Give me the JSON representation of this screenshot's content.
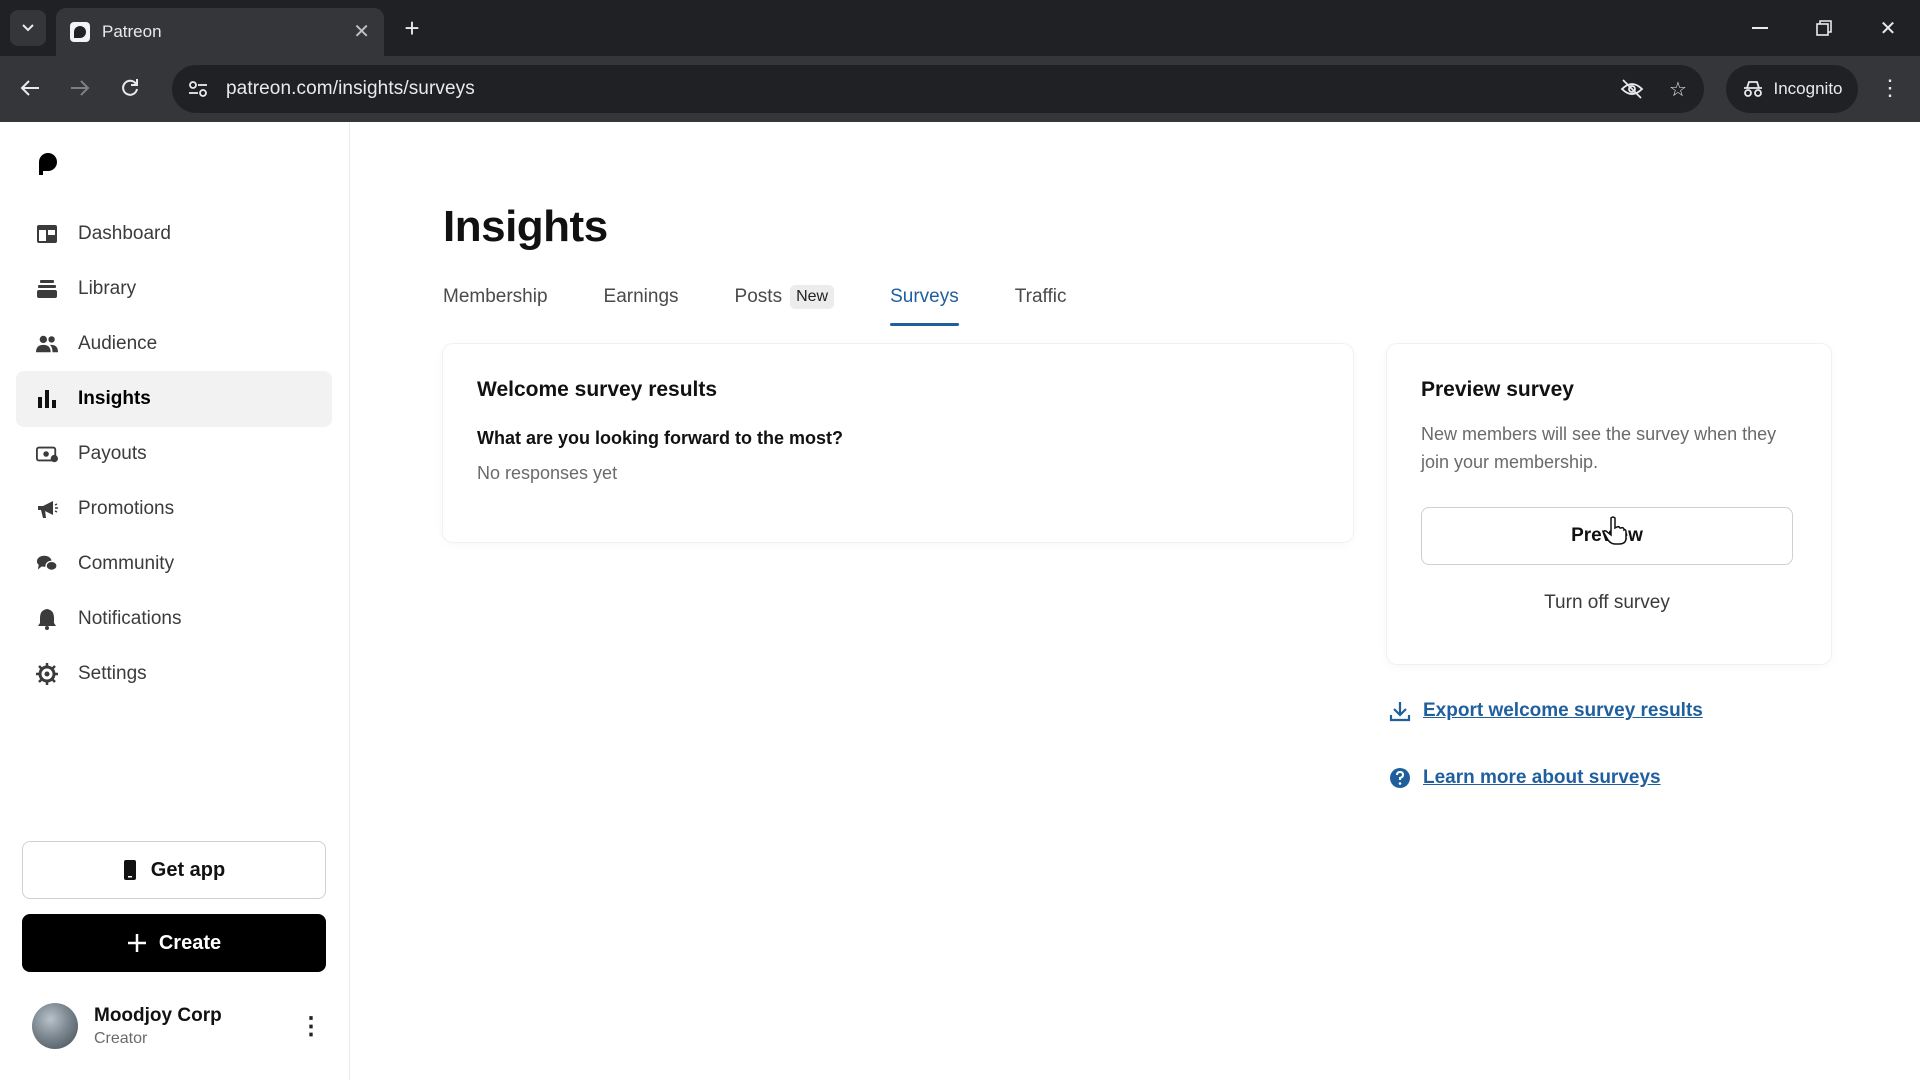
{
  "browser": {
    "tab_title": "Patreon",
    "url": "patreon.com/insights/surveys",
    "incognito_label": "Incognito"
  },
  "sidebar": {
    "items": [
      {
        "label": "Dashboard",
        "icon": "dashboard-icon",
        "active": false
      },
      {
        "label": "Library",
        "icon": "library-icon",
        "active": false
      },
      {
        "label": "Audience",
        "icon": "audience-icon",
        "active": false
      },
      {
        "label": "Insights",
        "icon": "insights-icon",
        "active": true
      },
      {
        "label": "Payouts",
        "icon": "payouts-icon",
        "active": false
      },
      {
        "label": "Promotions",
        "icon": "promotions-icon",
        "active": false
      },
      {
        "label": "Community",
        "icon": "community-icon",
        "active": false
      },
      {
        "label": "Notifications",
        "icon": "notifications-icon",
        "active": false
      },
      {
        "label": "Settings",
        "icon": "settings-icon",
        "active": false
      }
    ],
    "get_app_label": "Get app",
    "create_label": "Create",
    "profile": {
      "name": "Moodjoy Corp",
      "role": "Creator"
    }
  },
  "main": {
    "title": "Insights",
    "tabs": [
      {
        "label": "Membership",
        "active": false
      },
      {
        "label": "Earnings",
        "active": false
      },
      {
        "label": "Posts",
        "badge": "New",
        "active": false
      },
      {
        "label": "Surveys",
        "active": true
      },
      {
        "label": "Traffic",
        "active": false
      }
    ],
    "results_card": {
      "title": "Welcome survey results",
      "question": "What are you looking forward to the most?",
      "answer_status": "No responses yet"
    },
    "preview_card": {
      "title": "Preview survey",
      "description": "New members will see the survey when they join your membership.",
      "preview_button": "Preview",
      "turn_off_label": "Turn off survey"
    },
    "links": {
      "export": "Export welcome survey results",
      "learn_more": "Learn more about surveys"
    }
  },
  "colors": {
    "accent": "#1f5f9e",
    "primary_button": "#000000",
    "active_nav_bg": "#f2f2f2"
  }
}
